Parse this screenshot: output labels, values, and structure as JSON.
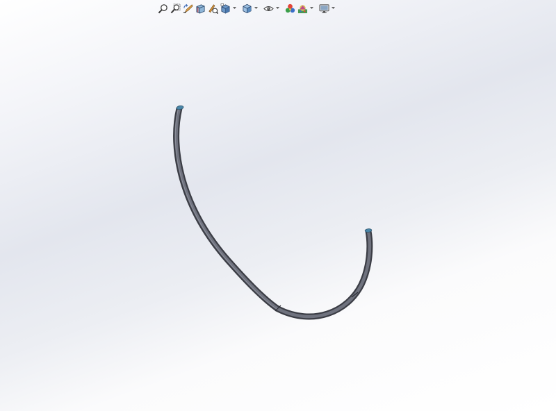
{
  "toolbar": {
    "tools": [
      {
        "id": "zoom-to-fit",
        "icon": "zoom-to-fit-icon"
      },
      {
        "id": "zoom-to-area",
        "icon": "zoom-to-area-icon"
      },
      {
        "id": "previous-view",
        "icon": "previous-view-icon"
      },
      {
        "id": "section-view",
        "icon": "section-view-icon"
      },
      {
        "id": "dynamic-annotation-views",
        "icon": "dynamic-annotation-icon"
      },
      {
        "id": "view-orientation",
        "icon": "view-orientation-icon",
        "dropdown": true
      },
      {
        "id": "display-style",
        "icon": "display-style-icon",
        "dropdown": true
      },
      {
        "id": "hide-show-items",
        "icon": "eye-icon",
        "dropdown": true
      },
      {
        "id": "edit-appearance",
        "icon": "appearance-icon"
      },
      {
        "id": "apply-scene",
        "icon": "scene-icon",
        "dropdown": true
      },
      {
        "id": "view-settings",
        "icon": "monitor-icon",
        "dropdown": true
      }
    ]
  },
  "model": {
    "part": "curved-tube",
    "body_color": "#5b5e69",
    "end_face_color": "#4a86a8"
  },
  "colors": {
    "background_top": "#ffffff",
    "background_mid": "#e3e6ee"
  }
}
